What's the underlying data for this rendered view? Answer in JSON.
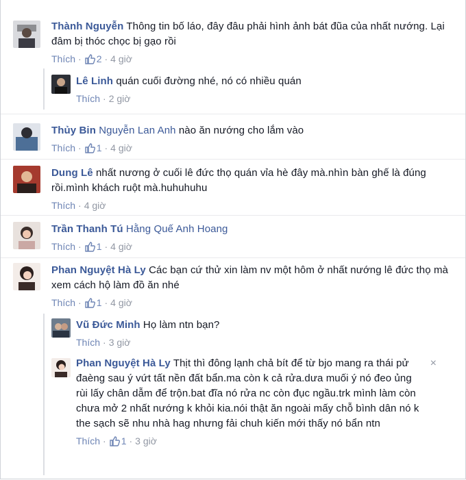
{
  "comments": [
    {
      "name": "Thành Nguyễn",
      "text": "Thông tin bố láo, đây đâu phải hình ảnh bát đũa của nhất nướng. Lại đâm bị thóc chọc bị gạo rồi",
      "like_label": "Thích",
      "like_count": "2",
      "time": "4 giờ"
    },
    {
      "name": "Lê Linh",
      "text": "quán cuối đường nhé, nó có nhiều quán",
      "like_label": "Thích",
      "time": "2 giờ"
    },
    {
      "name": "Thủy Bin",
      "tag": "Nguyễn Lan Anh",
      "text": "nào ăn nướng cho lắm vào",
      "like_label": "Thích",
      "like_count": "1",
      "time": "4 giờ"
    },
    {
      "name": "Dung Lê",
      "text": "nhất nương ở cuối lê đức thọ quán vỉa hè đây mà.nhìn bàn ghế là đúng rồi.mình khách ruột mà.huhuhuhu",
      "like_label": "Thích",
      "time": "4 giờ"
    },
    {
      "name": "Trần Thanh Tú",
      "tag": "Hằng Quế Anh Hoang",
      "like_label": "Thích",
      "like_count": "1",
      "time": "4 giờ"
    },
    {
      "name": "Phan Nguyệt Hà Ly",
      "text": "Các bạn cứ thử xin làm nv một hôm ở nhất nướng lê đức thọ mà xem cách hộ làm đồ ăn nhé",
      "like_label": "Thích",
      "like_count": "1",
      "time": "4 giờ"
    },
    {
      "name": "Vũ Đức Minh",
      "text": "Họ làm ntn bạn?",
      "like_label": "Thích",
      "time": "3 giờ"
    },
    {
      "name": "Phan Nguyệt Hà Ly",
      "text": "Thịt thì đông lạnh chả bít để từ bjo mang ra thái pử đaèng sau ý vứt tất nền đất bẩn.ma còn k cả rửa.dưa muối ý nó đeo ủng rùi lấy chân dẫm để trộn.bat đĩa nó rửa nc còn đục ngầu.trk mình làm còn chưa mở 2 nhất nướng k khỏi kia.nói thật ăn ngoài mấy chỗ bình dân nó k the sạch sẽ nhu nhà hag nhưng fải chuh kiến mới thấy nó bẩn ntn",
      "like_label": "Thích",
      "like_count": "1",
      "time": "3 giờ"
    }
  ],
  "close_symbol": "×",
  "colors": {
    "link": "#3b5998",
    "meta": "#9197a3",
    "like": "#6d84b4"
  },
  "icons": {
    "like": "thumbs-up-icon",
    "close": "close-icon"
  }
}
